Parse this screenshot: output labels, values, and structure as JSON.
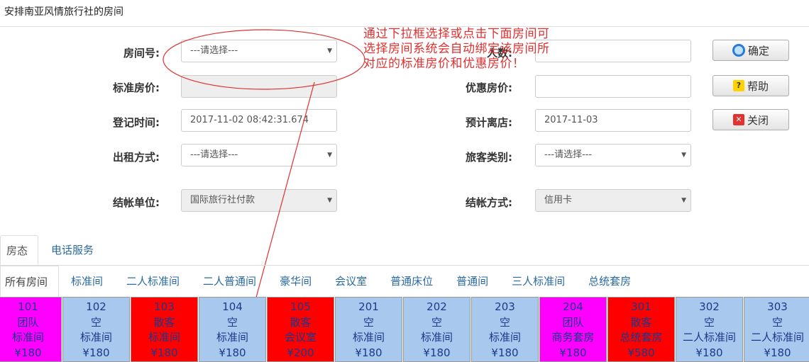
{
  "page": {
    "title": "安排南亚风情旅行社的房间"
  },
  "form": {
    "room_no": {
      "label": "房间号:",
      "value": "---请选择---"
    },
    "guests": {
      "label": "人数:",
      "value": ""
    },
    "std_price": {
      "label": "标准房价:",
      "value": ""
    },
    "discount_price": {
      "label": "优惠房价:",
      "value": ""
    },
    "checkin_time": {
      "label": "登记时间:",
      "value": "2017-11-02 08:42:31.674"
    },
    "checkout_date": {
      "label": "预计离店:",
      "value": "2017-11-03"
    },
    "rent_mode": {
      "label": "出租方式:",
      "value": "---请选择---"
    },
    "guest_type": {
      "label": "旅客类别:",
      "value": "---请选择---"
    },
    "settle_unit": {
      "label": "结帐单位:",
      "value": "国际旅行社付款"
    },
    "pay_method": {
      "label": "结帐方式:",
      "value": "信用卡"
    }
  },
  "buttons": {
    "confirm": "确定",
    "help": "帮助",
    "close": "关闭"
  },
  "annotation": {
    "text": "通过下拉框选择或点击下面房间可选择房间系统会自动绑定该房间所对应的标准房价和优惠房价！",
    "color": "#e23030"
  },
  "tabs": [
    {
      "label": "房态"
    },
    {
      "label": "电话服务"
    }
  ],
  "room_types": [
    {
      "label": "所有房间"
    },
    {
      "label": "标准间"
    },
    {
      "label": "二人标准间"
    },
    {
      "label": "二人普通间"
    },
    {
      "label": "豪华间"
    },
    {
      "label": "会议室"
    },
    {
      "label": "普通床位"
    },
    {
      "label": "普通间"
    },
    {
      "label": "三人标准间"
    },
    {
      "label": "总统套房"
    }
  ],
  "status_colors": {
    "team": "#ff00ff",
    "empty": "#a9c8ee",
    "individual": "#ff0000"
  },
  "rooms": [
    {
      "no": "101",
      "status": "团队",
      "type": "标准间",
      "price": "¥180",
      "color": "#ff00ff"
    },
    {
      "no": "102",
      "status": "空",
      "type": "标准间",
      "price": "¥180",
      "color": "#a9c8ee"
    },
    {
      "no": "103",
      "status": "散客",
      "type": "标准间",
      "price": "¥180",
      "color": "#ff0000"
    },
    {
      "no": "104",
      "status": "空",
      "type": "标准间",
      "price": "¥180",
      "color": "#a9c8ee"
    },
    {
      "no": "105",
      "status": "散客",
      "type": "会议室",
      "price": "¥200",
      "color": "#ff0000"
    },
    {
      "no": "201",
      "status": "空",
      "type": "标准间",
      "price": "¥180",
      "color": "#a9c8ee"
    },
    {
      "no": "202",
      "status": "空",
      "type": "标准间",
      "price": "¥180",
      "color": "#a9c8ee"
    },
    {
      "no": "203",
      "status": "空",
      "type": "标准间",
      "price": "¥180",
      "color": "#a9c8ee"
    },
    {
      "no": "204",
      "status": "团队",
      "type": "商务套房",
      "price": "¥180",
      "color": "#ff00ff"
    },
    {
      "no": "301",
      "status": "散客",
      "type": "总统套房",
      "price": "¥580",
      "color": "#ff0000"
    },
    {
      "no": "302",
      "status": "空",
      "type": "二人标准间",
      "price": "¥180",
      "color": "#a9c8ee"
    },
    {
      "no": "303",
      "status": "空",
      "type": "二人标准间",
      "price": "¥180",
      "color": "#a9c8ee"
    }
  ]
}
